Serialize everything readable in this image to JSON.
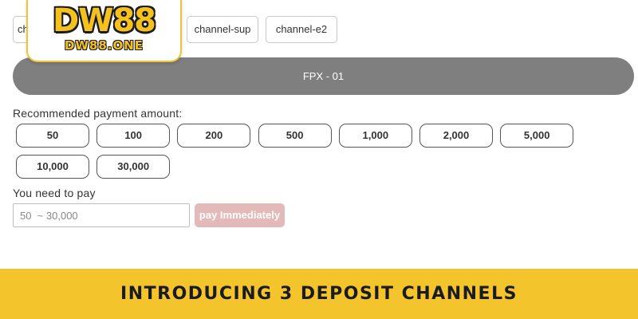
{
  "logo": {
    "main_text": "DW88",
    "sub_text": "DW88.ONE",
    "colors": {
      "fill": "#f4c11f",
      "outline": "#1b1b1b"
    }
  },
  "channels": [
    {
      "label": "ch"
    },
    {
      "label": "channel-sup"
    },
    {
      "label": "channel-e2"
    }
  ],
  "payment_method": {
    "label": "FPX - 01"
  },
  "recommended": {
    "label": "Recommended payment amount:",
    "amounts": [
      "50",
      "100",
      "200",
      "500",
      "1,000",
      "2,000",
      "5,000",
      "10,000",
      "30,000"
    ]
  },
  "pay": {
    "label": "You need to pay",
    "placeholder": "50  ~ 30,000",
    "button_label": "pay Immediately"
  },
  "banner": {
    "text": "INTRODUCING 3 DEPOSIT CHANNELS",
    "color": "#f3c42b"
  }
}
